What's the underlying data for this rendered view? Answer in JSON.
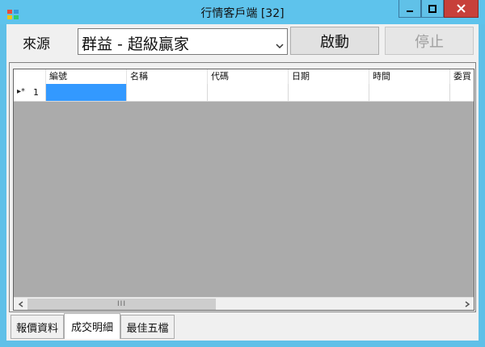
{
  "window": {
    "title": "行情客戶端 [32]",
    "icons": {
      "app": "app-icon",
      "minimize": "minimize-icon",
      "maximize": "maximize-icon",
      "close": "close-icon"
    }
  },
  "toolbar": {
    "source_label": "來源",
    "source_value": "群益 - 超級贏家",
    "start_label": "啟動",
    "stop_label": "停止"
  },
  "grid": {
    "columns": [
      "編號",
      "名稱",
      "代碼",
      "日期",
      "時間",
      "委買"
    ],
    "rows": [
      {
        "marker": "▸*",
        "index": "1"
      }
    ],
    "scroll_thumb_glyph": "III"
  },
  "tabs": [
    {
      "label": "報價資料"
    },
    {
      "label": "成交明細"
    },
    {
      "label": "最佳五檔"
    }
  ],
  "colors": {
    "titlebar": "#5ec3ec",
    "close_button": "#c7403a",
    "selected_cell": "#3399ff",
    "grid_background": "#ababab"
  }
}
